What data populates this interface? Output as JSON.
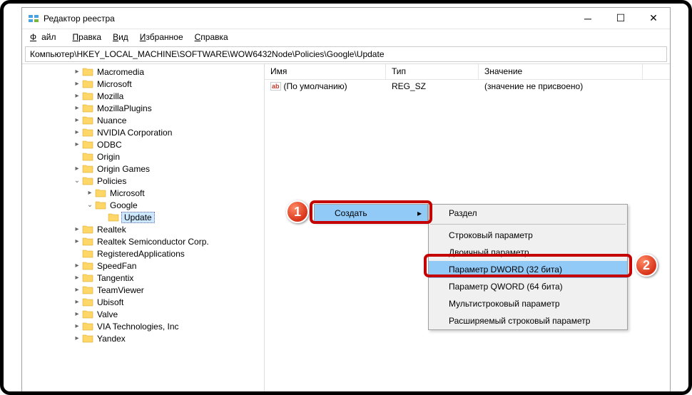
{
  "window": {
    "title": "Редактор реестра"
  },
  "menu": {
    "file": "Файл",
    "edit": "Правка",
    "view": "Вид",
    "favorites": "Избранное",
    "help": "Справка"
  },
  "path": "Компьютер\\HKEY_LOCAL_MACHINE\\SOFTWARE\\WOW6432Node\\Policies\\Google\\Update",
  "tree": [
    {
      "label": "Macromedia",
      "indent": 0,
      "caret": "▸"
    },
    {
      "label": "Microsoft",
      "indent": 0,
      "caret": "▸"
    },
    {
      "label": "Mozilla",
      "indent": 0,
      "caret": "▸"
    },
    {
      "label": "MozillaPlugins",
      "indent": 0,
      "caret": "▸"
    },
    {
      "label": "Nuance",
      "indent": 0,
      "caret": "▸"
    },
    {
      "label": "NVIDIA Corporation",
      "indent": 0,
      "caret": "▸"
    },
    {
      "label": "ODBC",
      "indent": 0,
      "caret": "▸"
    },
    {
      "label": "Origin",
      "indent": 0,
      "caret": ""
    },
    {
      "label": "Origin Games",
      "indent": 0,
      "caret": "▸"
    },
    {
      "label": "Policies",
      "indent": 0,
      "caret": "⌄",
      "expanded": true
    },
    {
      "label": "Microsoft",
      "indent": 1,
      "caret": "▸"
    },
    {
      "label": "Google",
      "indent": 1,
      "caret": "⌄",
      "expanded": true
    },
    {
      "label": "Update",
      "indent": 2,
      "caret": "",
      "selected": true
    },
    {
      "label": "Realtek",
      "indent": 0,
      "caret": "▸"
    },
    {
      "label": "Realtek Semiconductor Corp.",
      "indent": 0,
      "caret": "▸"
    },
    {
      "label": "RegisteredApplications",
      "indent": 0,
      "caret": ""
    },
    {
      "label": "SpeedFan",
      "indent": 0,
      "caret": "▸"
    },
    {
      "label": "Tangentix",
      "indent": 0,
      "caret": "▸"
    },
    {
      "label": "TeamViewer",
      "indent": 0,
      "caret": "▸"
    },
    {
      "label": "Ubisoft",
      "indent": 0,
      "caret": "▸"
    },
    {
      "label": "Valve",
      "indent": 0,
      "caret": "▸"
    },
    {
      "label": "VIA Technologies, Inc",
      "indent": 0,
      "caret": "▸"
    },
    {
      "label": "Yandex",
      "indent": 0,
      "caret": "▸"
    }
  ],
  "columns": {
    "name": "Имя",
    "type": "Тип",
    "value": "Значение"
  },
  "rows": [
    {
      "name": "(По умолчанию)",
      "type": "REG_SZ",
      "value": "(значение не присвоено)"
    }
  ],
  "contextMenu1": {
    "create": "Создать"
  },
  "contextMenu2": {
    "key": "Раздел",
    "string": "Строковый параметр",
    "binary": "Двоичный параметр",
    "dword": "Параметр DWORD (32 бита)",
    "qword": "Параметр QWORD (64 бита)",
    "multistring": "Мультистроковый параметр",
    "expandstring": "Расширяемый строковый параметр"
  },
  "badges": {
    "n1": "1",
    "n2": "2"
  }
}
